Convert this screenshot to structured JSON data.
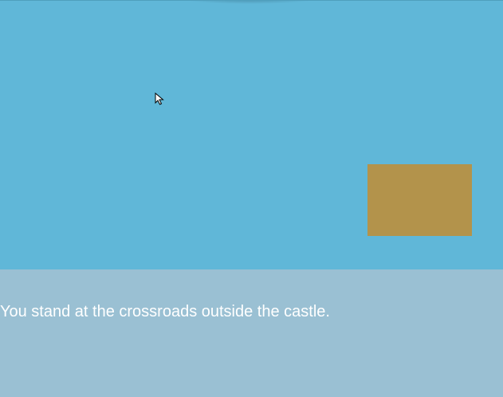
{
  "scene": {
    "background_color": "#60b7d8",
    "object": {
      "color": "#b3934b"
    }
  },
  "cursor": {
    "icon": "arrow-pointer-icon"
  },
  "text_panel": {
    "background_color": "#9ac0d3",
    "narration": "You stand at the crossroads outside the castle."
  }
}
